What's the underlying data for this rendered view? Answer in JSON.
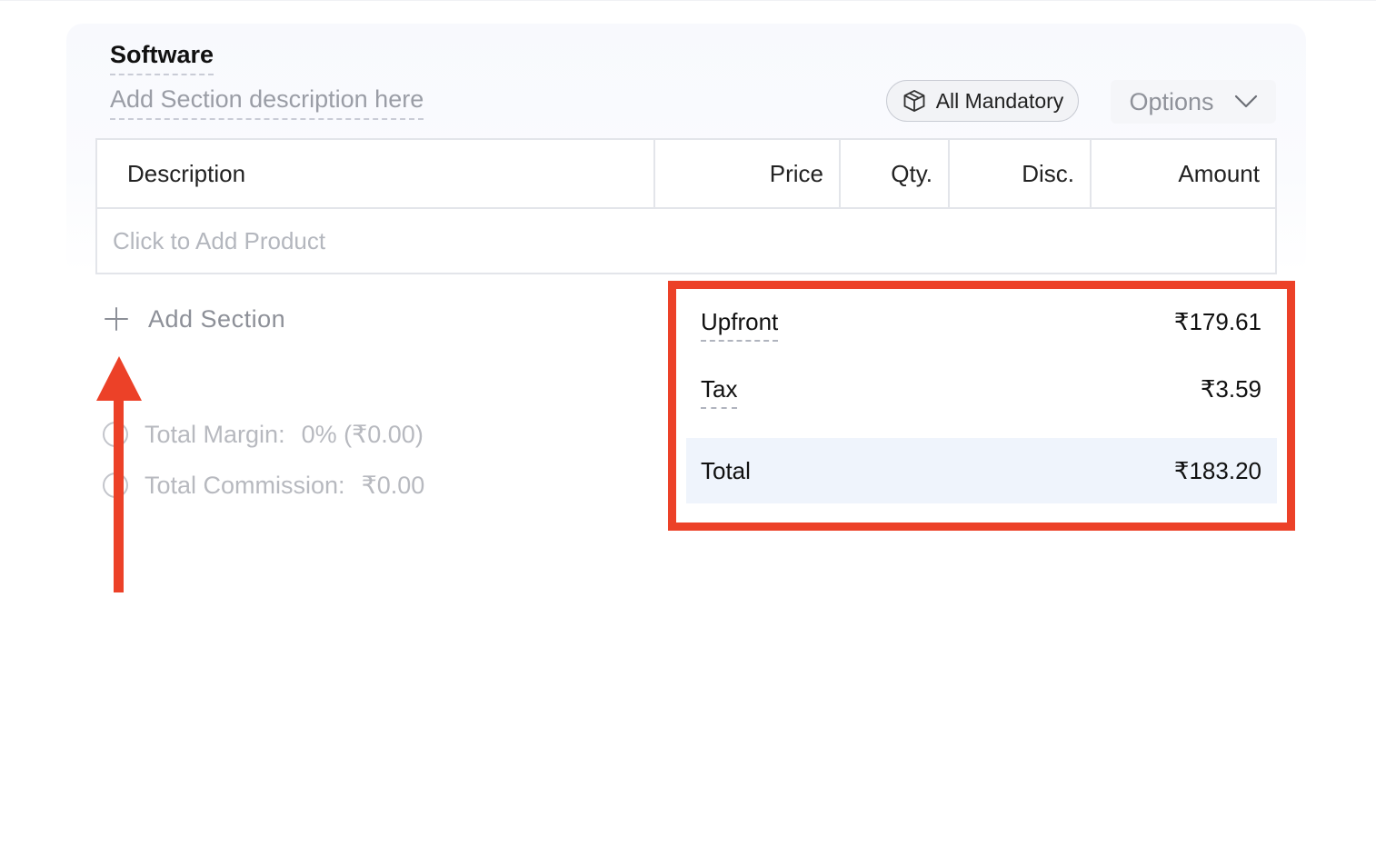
{
  "section": {
    "title": "Software",
    "description_placeholder": "Add Section description here",
    "mandatory_label": "All Mandatory",
    "options_label": "Options"
  },
  "table": {
    "headers": {
      "description": "Description",
      "price": "Price",
      "qty": "Qty.",
      "disc": "Disc.",
      "amount": "Amount"
    },
    "add_product_placeholder": "Click to Add Product"
  },
  "add_section_label": "Add Section",
  "margins": {
    "total_margin_label": "Total Margin:",
    "total_margin_value": "0% (₹0.00)",
    "total_commission_label": "Total Commission:",
    "total_commission_value": "₹0.00"
  },
  "summary": {
    "upfront_label": "Upfront",
    "upfront_value": "₹179.61",
    "tax_label": "Tax",
    "tax_value": "₹3.59",
    "total_label": "Total",
    "total_value": "₹183.20"
  },
  "colors": {
    "annotation": "#ec4128",
    "total_band": "#eff4fc",
    "border": "#e3e5ea",
    "muted_text": "#9a9da6"
  },
  "icons": {
    "mandatory": "cube-icon",
    "options": "chevron-down-icon",
    "add_section": "plus-icon"
  }
}
